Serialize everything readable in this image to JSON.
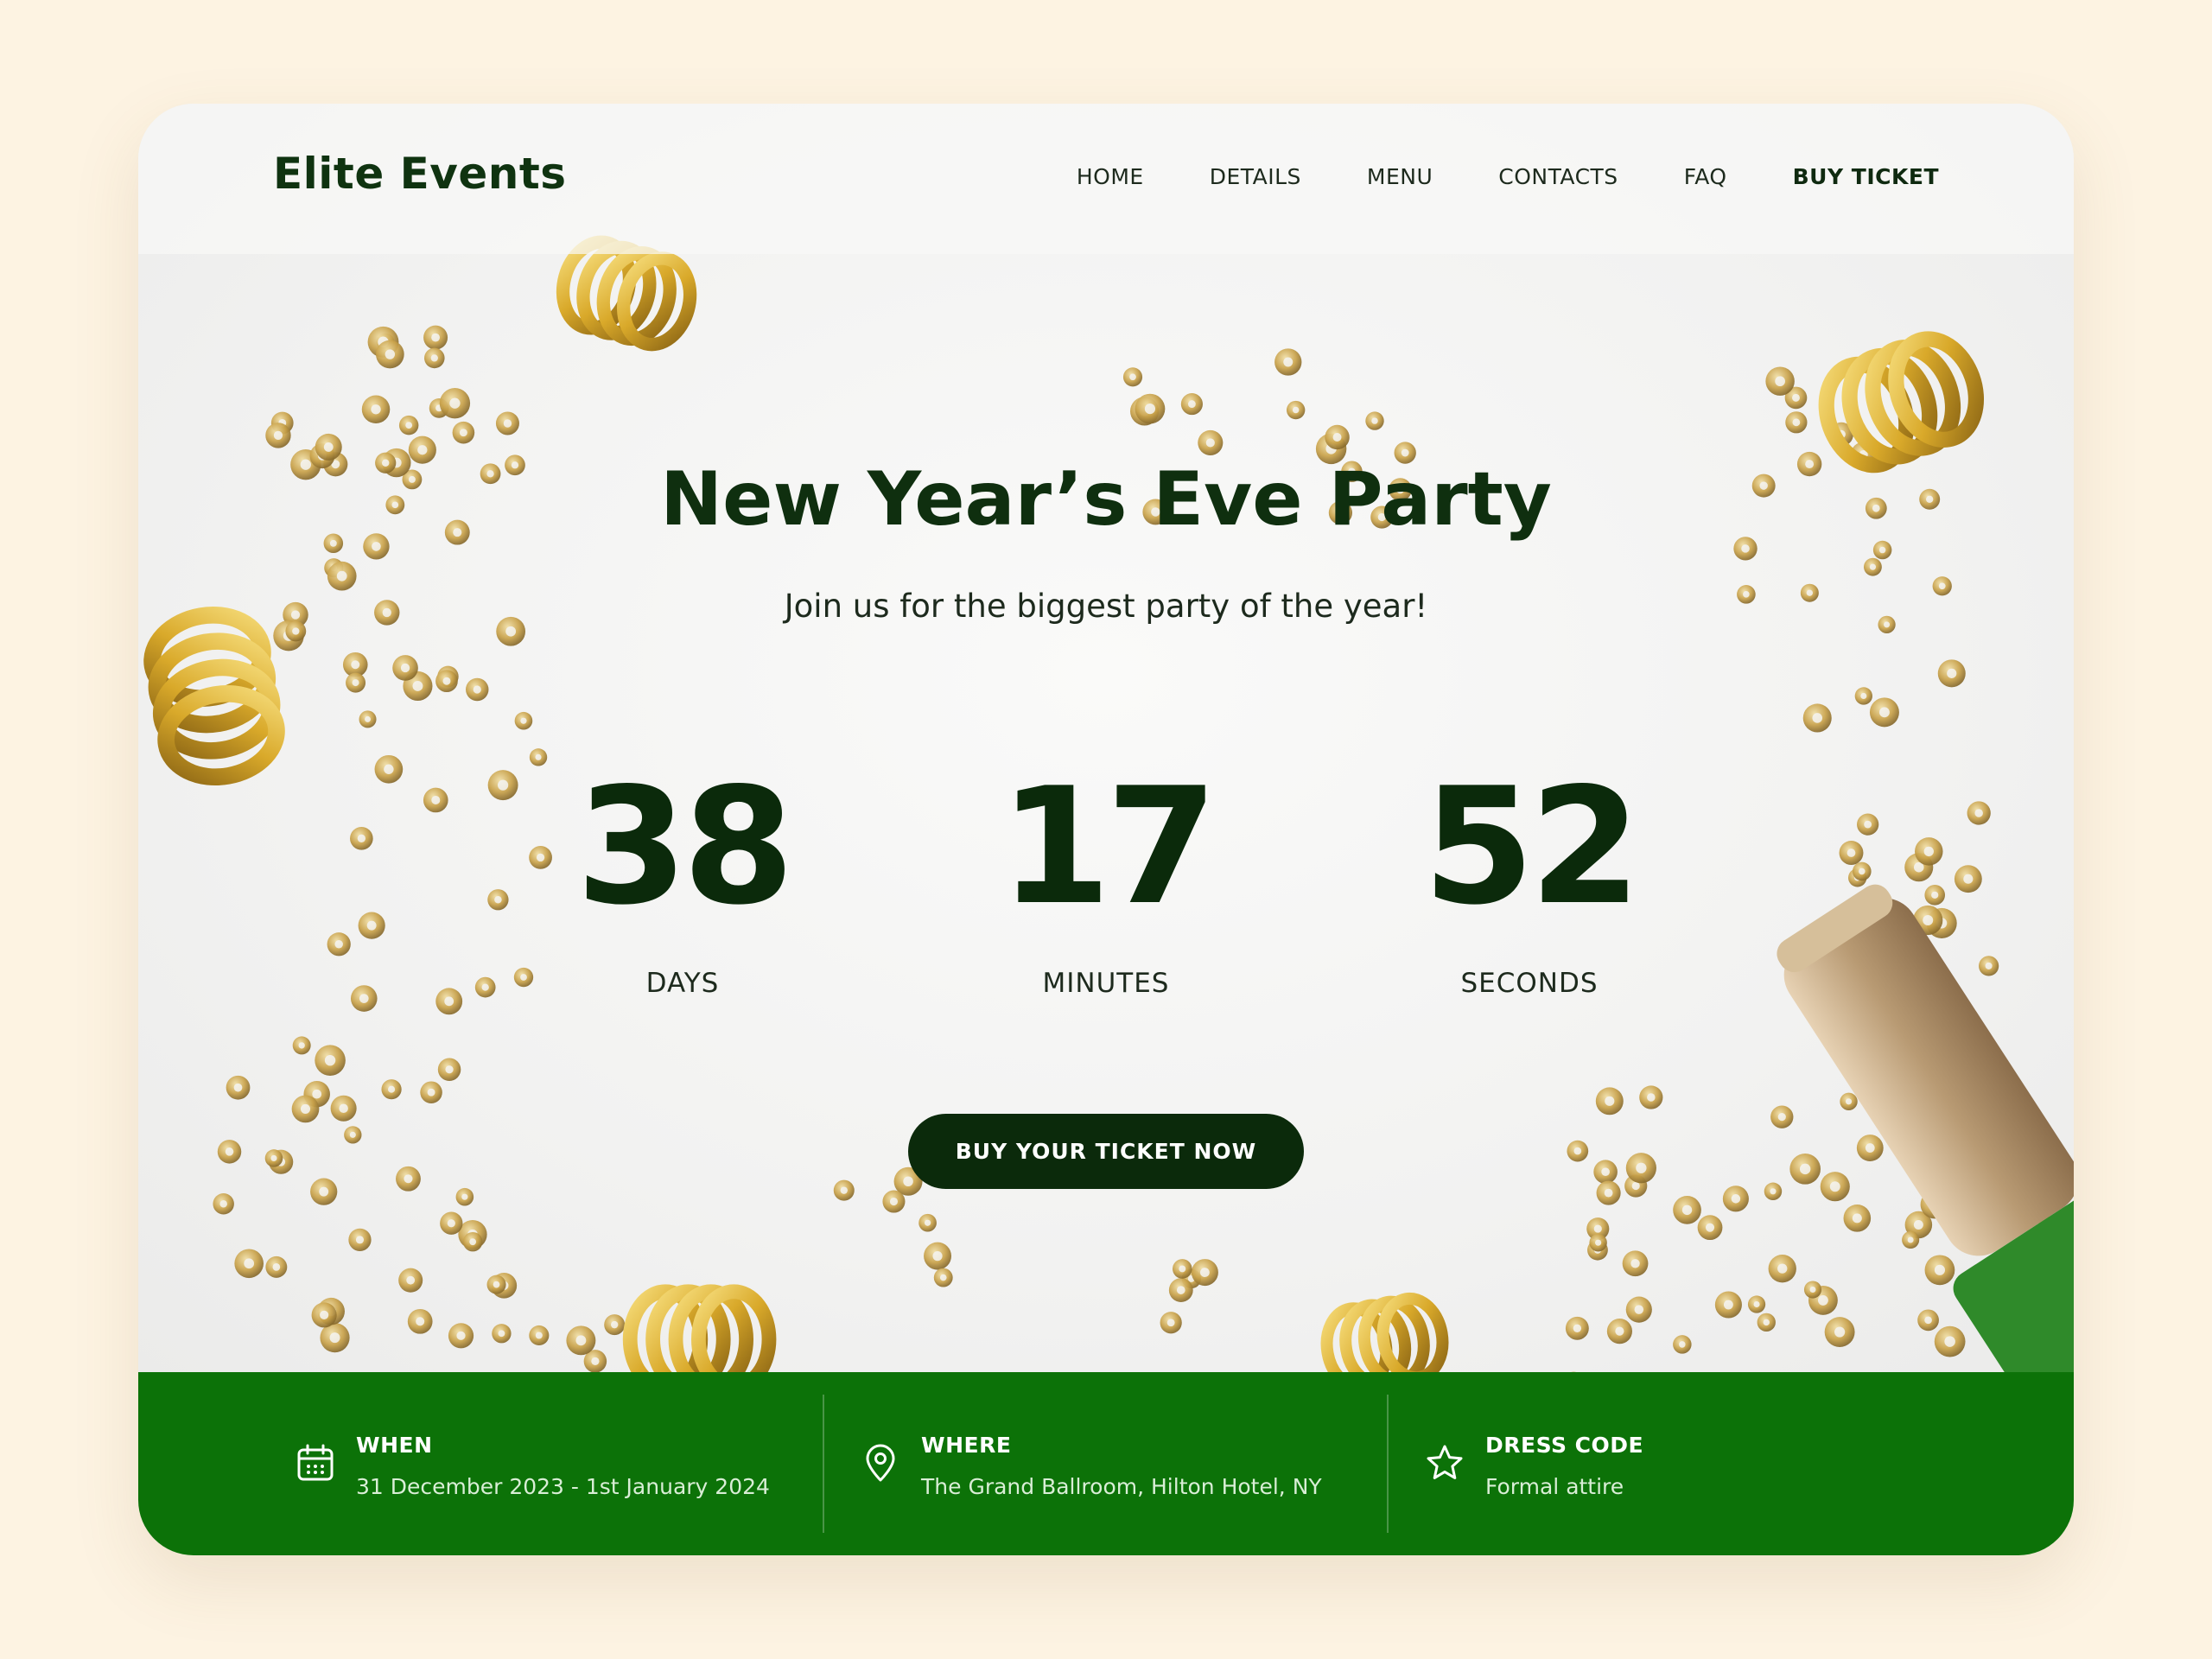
{
  "brand": {
    "logo_text": "Elite Events"
  },
  "nav": {
    "items": [
      "HOME",
      "DETAILS",
      "MENU",
      "CONTACTS",
      "FAQ",
      "BUY TICKET"
    ]
  },
  "hero": {
    "title": "New Year’s Eve Party",
    "subtitle": "Join us for the biggest party of the year!",
    "countdown": [
      {
        "value": "38",
        "label": "DAYS"
      },
      {
        "value": "17",
        "label": "MINUTES"
      },
      {
        "value": "52",
        "label": "SECONDS"
      }
    ],
    "cta_label": "BUY YOUR TICKET NOW"
  },
  "info": [
    {
      "icon": "calendar-icon",
      "heading": "WHEN",
      "value": "31 December 2023 - 1st January 2024"
    },
    {
      "icon": "location-pin-icon",
      "heading": "WHERE",
      "value": "The Grand Ballroom, Hilton Hotel, NY"
    },
    {
      "icon": "star-icon",
      "heading": "DRESS CODE",
      "value": "Formal attire"
    }
  ],
  "colors": {
    "page_background": "#fdf3e2",
    "dark_green": "#0b2a0b",
    "info_bar_green": "#0c7208",
    "gold": "#c9a24a"
  }
}
